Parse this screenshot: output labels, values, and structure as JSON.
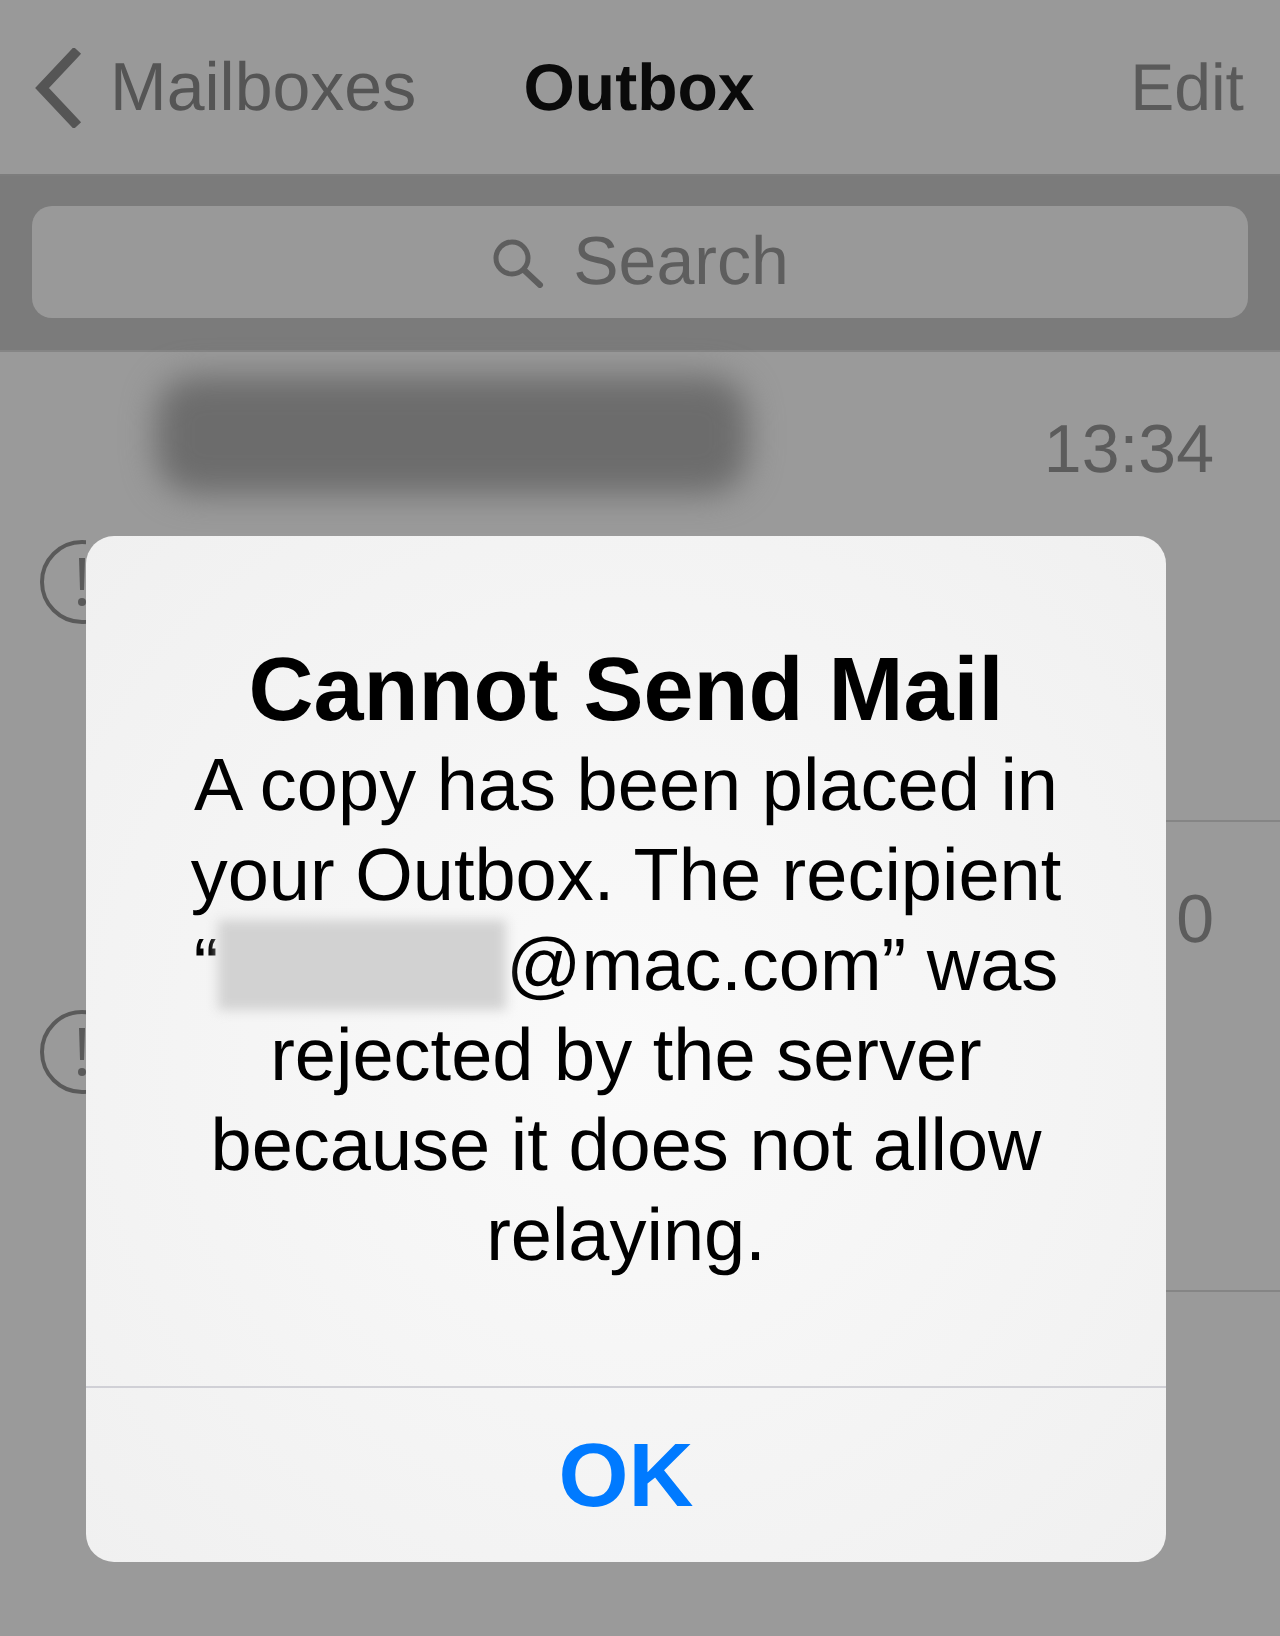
{
  "nav_bar": {
    "back_label": "Mailboxes",
    "title": "Outbox",
    "action": "Edit"
  },
  "search": {
    "placeholder": "Search"
  },
  "messages": [
    {
      "sender_redacted": true,
      "time": "13:34",
      "error": true
    },
    {
      "time": "0",
      "error": true
    }
  ],
  "alert": {
    "title": "Cannot Send Mail",
    "message_parts": [
      {
        "kind": "text",
        "text": "A copy has been placed in your Outbox. The recipient “"
      },
      {
        "kind": "redacted"
      },
      {
        "kind": "text",
        "text": "@mac.com” was rejected by the server because it does not allow relaying."
      }
    ],
    "button": "OK"
  }
}
